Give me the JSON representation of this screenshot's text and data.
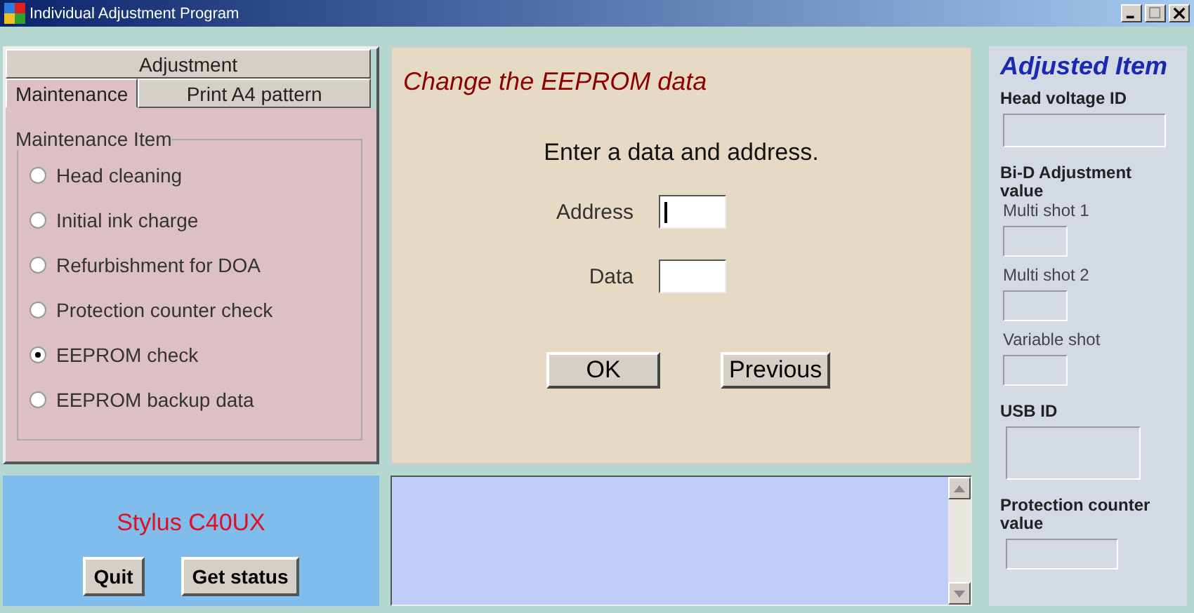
{
  "window": {
    "title": "Individual Adjustment Program"
  },
  "tab_rows": [
    [
      {
        "label": "Adjustment",
        "selected": false
      }
    ],
    [
      {
        "label": "Maintenance",
        "selected": true
      },
      {
        "label": "Print A4 pattern",
        "selected": false
      }
    ]
  ],
  "maintenance_group": {
    "title": "Maintenance Item",
    "options": [
      {
        "label": "Head cleaning",
        "selected": false
      },
      {
        "label": "Initial ink charge",
        "selected": false
      },
      {
        "label": "Refurbishment for DOA",
        "selected": false
      },
      {
        "label": "Protection counter check",
        "selected": false
      },
      {
        "label": "EEPROM check",
        "selected": true
      },
      {
        "label": "EEPROM backup data",
        "selected": false
      }
    ]
  },
  "model_panel": {
    "model": "Stylus C40UX",
    "buttons": [
      "Quit",
      "Get status"
    ]
  },
  "main_panel": {
    "heading": "Change the EEPROM data",
    "instruction": "Enter a data and address.",
    "fields": [
      {
        "label": "Address",
        "focused": true
      },
      {
        "label": "Data",
        "focused": false
      }
    ],
    "buttons": [
      "OK",
      "Previous"
    ]
  },
  "adjusted_panel": {
    "title": "Adjusted Item",
    "items": [
      {
        "kind": "heading",
        "label": "Head voltage ID"
      },
      {
        "kind": "field"
      },
      {
        "kind": "heading",
        "label": "Bi-D Adjustment value"
      },
      {
        "kind": "label",
        "label": "Multi shot 1"
      },
      {
        "kind": "field"
      },
      {
        "kind": "label",
        "label": "Multi shot 2"
      },
      {
        "kind": "field"
      },
      {
        "kind": "label",
        "label": "Variable shot"
      },
      {
        "kind": "field"
      },
      {
        "kind": "heading",
        "label": "USB ID"
      },
      {
        "kind": "field"
      },
      {
        "kind": "heading",
        "label": "Protection counter value"
      },
      {
        "kind": "field"
      }
    ]
  }
}
